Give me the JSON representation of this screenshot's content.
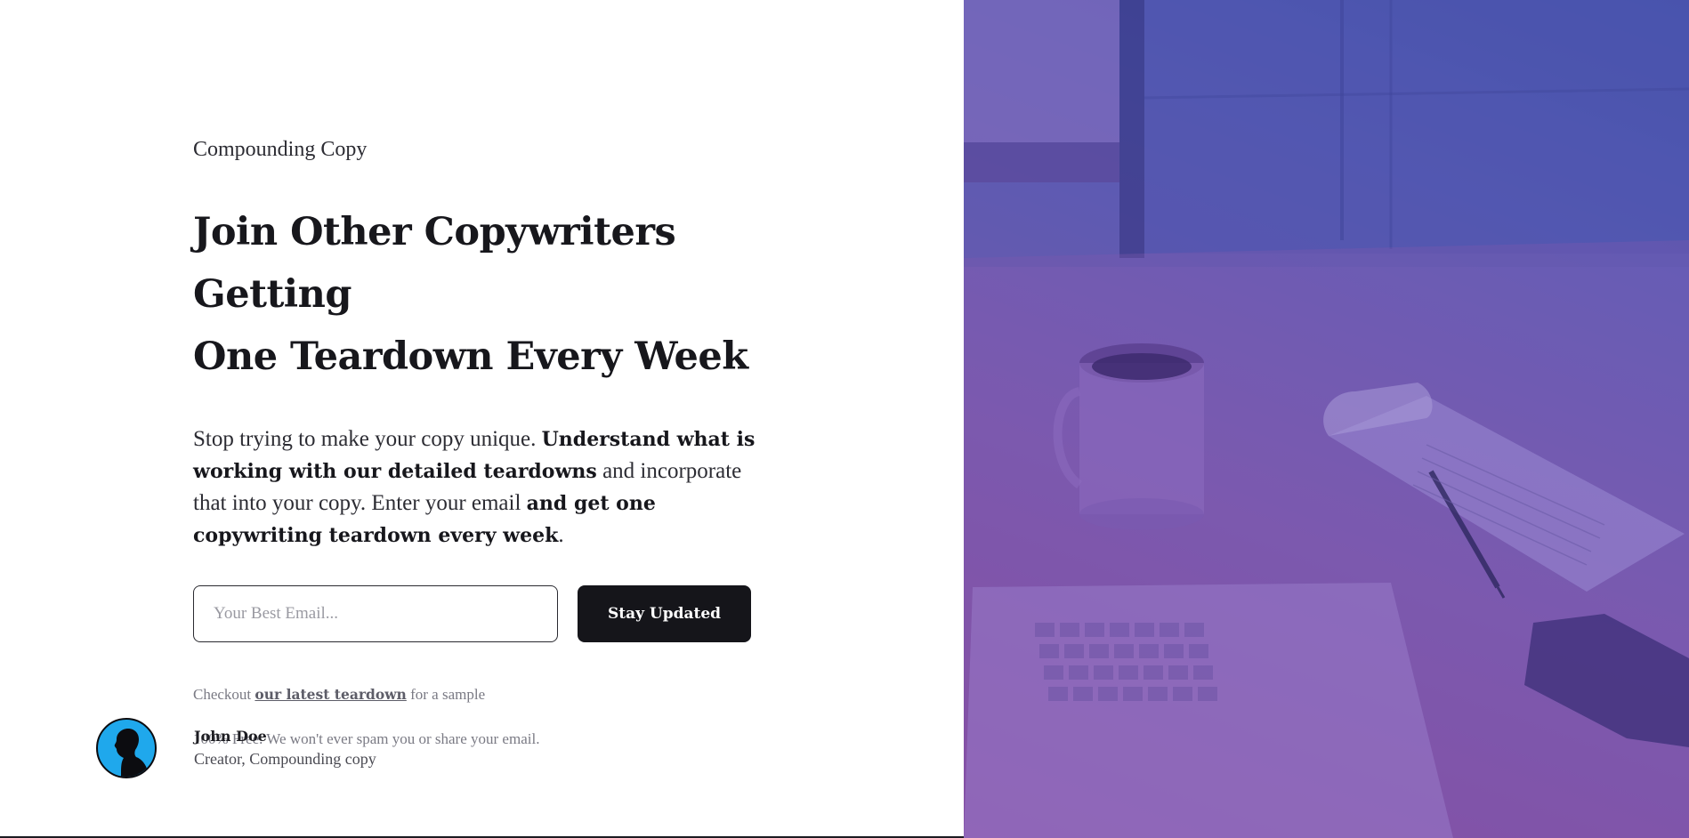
{
  "brand": {
    "name": "Compounding Copy"
  },
  "hero": {
    "headline_line1": "Join Other Copywriters Getting",
    "headline_line2": "One Teardown Every Week",
    "lead_part1": "Stop trying to make your copy unique. ",
    "lead_bold1": "Understand what is working with our detailed teardowns",
    "lead_part2": " and incorporate that into your copy. Enter your email ",
    "lead_bold2": "and get one copywriting teardown every week",
    "lead_part3": "."
  },
  "form": {
    "email_placeholder": "Your Best Email...",
    "email_value": "",
    "submit_label": "Stay Updated"
  },
  "notes": {
    "sample_prefix": "Checkout ",
    "sample_link": "our latest teardown",
    "sample_suffix": " for a sample",
    "privacy": "100% Free. We won't ever spam you or share your email."
  },
  "author": {
    "name": "John Doe",
    "role": "Creator, Compounding copy"
  },
  "colors": {
    "button_bg": "#15151a",
    "avatar_bg": "#1fa8ec",
    "gradient_purple": "#8a4a9e",
    "gradient_blue": "#3f55b0"
  },
  "icons": {
    "avatar": "person-silhouette-icon"
  }
}
